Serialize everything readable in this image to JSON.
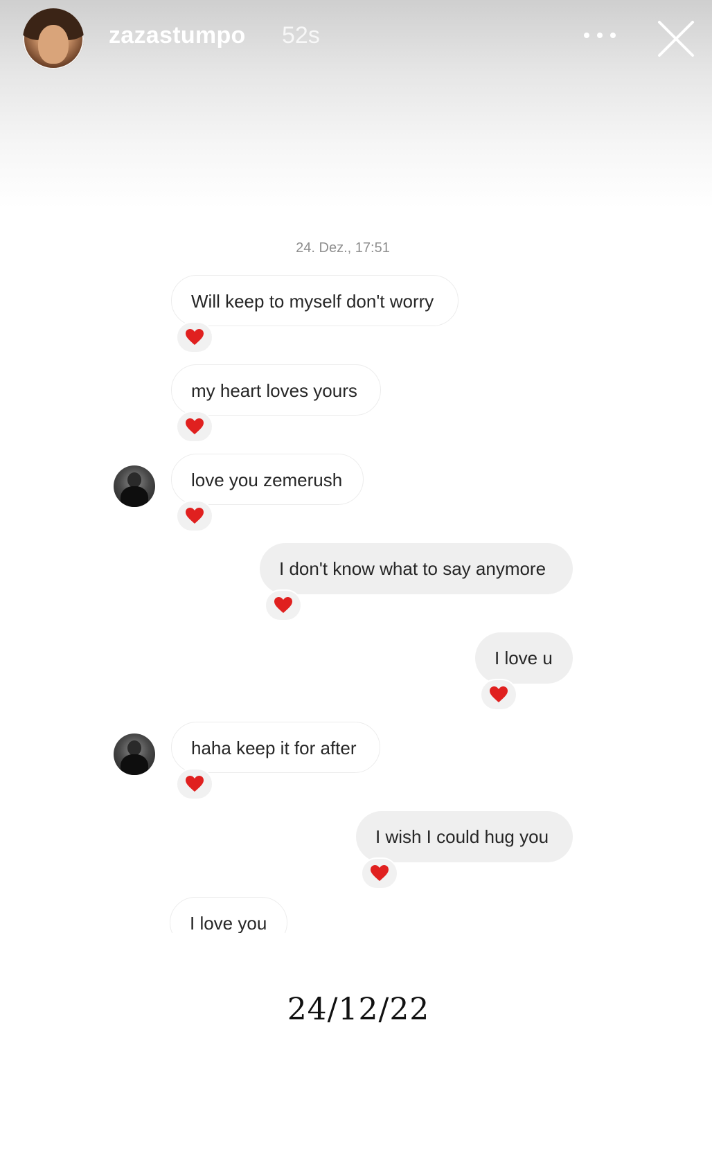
{
  "story": {
    "username": "zazastumpo",
    "time_ago": "52s"
  },
  "caption": "24/12/22",
  "chat": {
    "timestamp": "24. Dez., 17:51",
    "reaction_emoji": "heart",
    "heart_color": "#e0201f",
    "messages": [
      {
        "text": "Will keep to myself don't worry",
        "direction": "incoming",
        "reaction": "heart",
        "show_avatar": false
      },
      {
        "text": "my heart loves yours",
        "direction": "incoming",
        "reaction": "heart",
        "show_avatar": false
      },
      {
        "text": "love you zemerush",
        "direction": "incoming",
        "reaction": "heart",
        "show_avatar": true
      },
      {
        "text": "I don't know what to say anymore",
        "direction": "outgoing",
        "reaction": "heart",
        "show_avatar": false
      },
      {
        "text": "I love u",
        "direction": "outgoing",
        "reaction": "heart",
        "show_avatar": false
      },
      {
        "text": "haha keep it for after",
        "direction": "incoming",
        "reaction": "heart",
        "show_avatar": true
      },
      {
        "text": "I wish I could hug you",
        "direction": "outgoing",
        "reaction": "heart",
        "show_avatar": false
      },
      {
        "text": "I love you",
        "direction": "incoming",
        "reaction": null,
        "show_avatar": false
      }
    ]
  }
}
